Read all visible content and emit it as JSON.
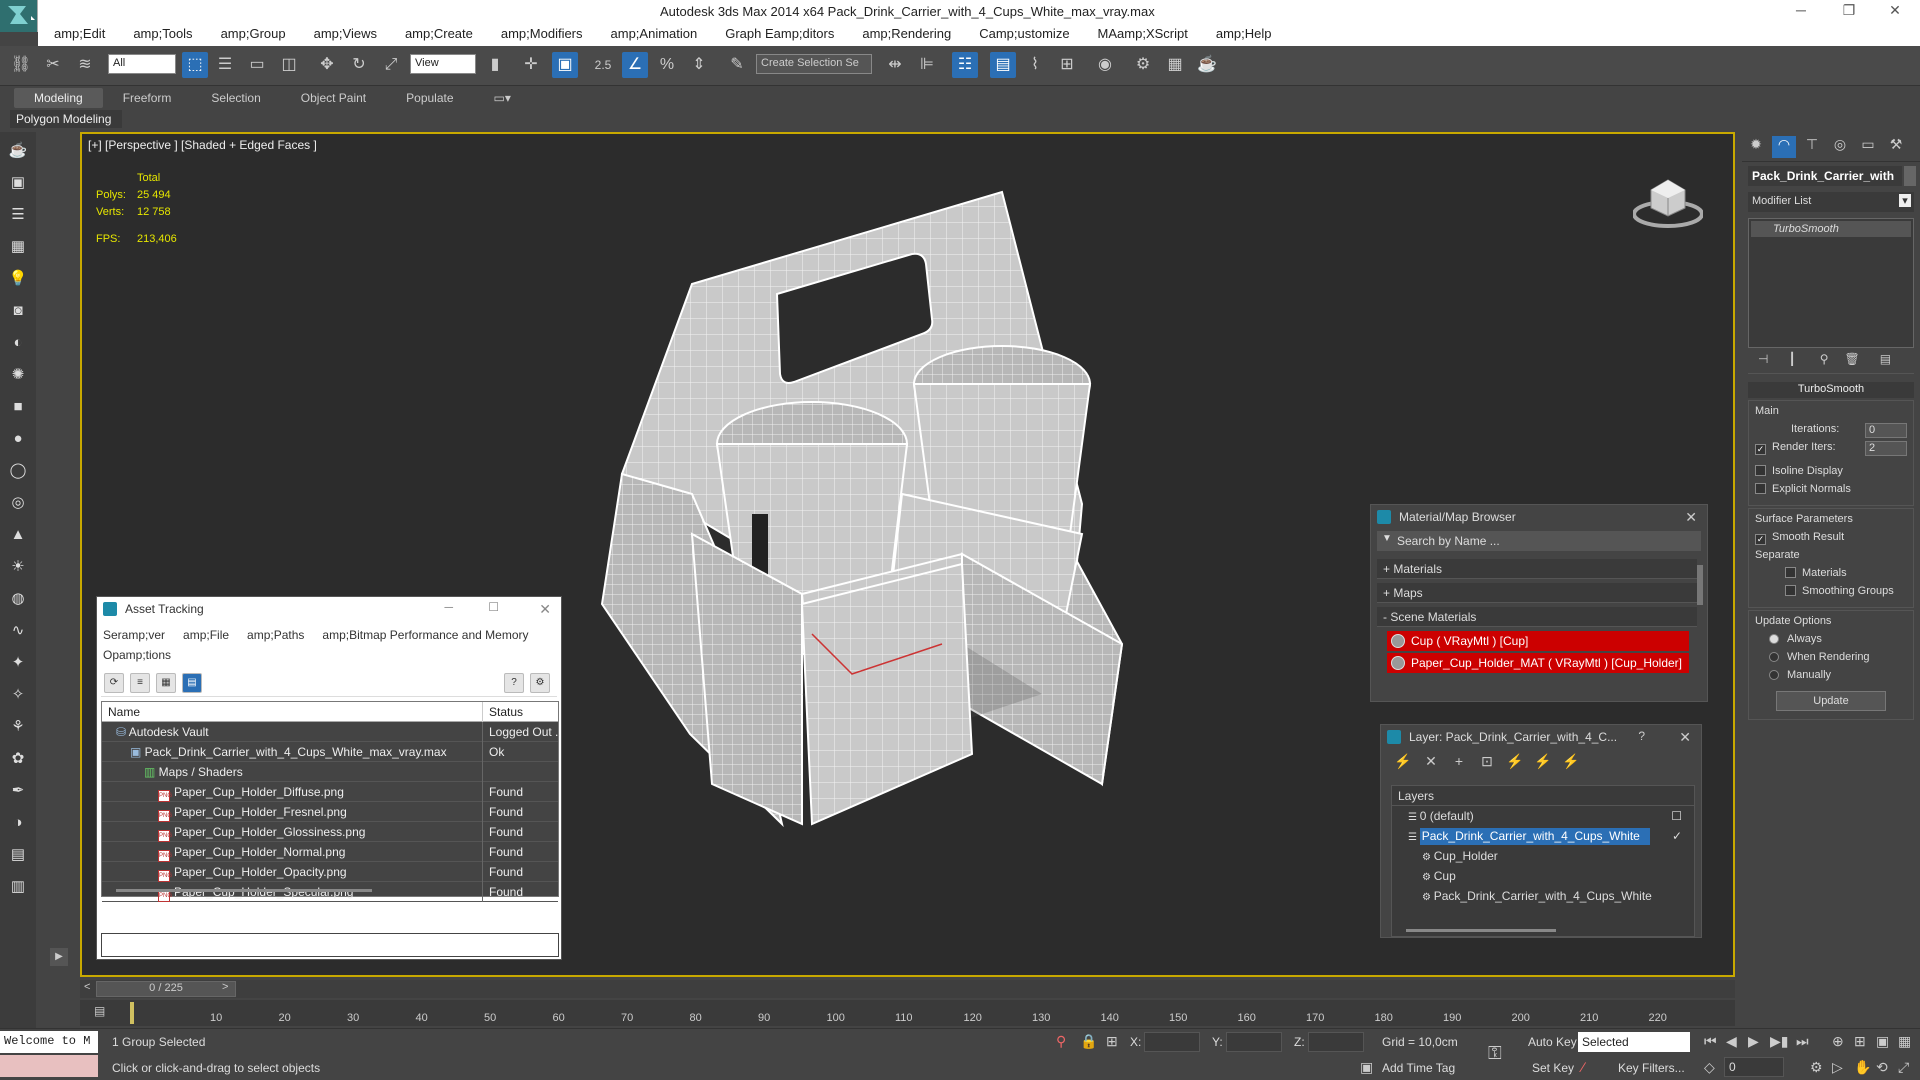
{
  "app": {
    "title": "Autodesk 3ds Max  2014 x64     Pack_Drink_Carrier_with_4_Cups_White_max_vray.max",
    "window_controls": {
      "minimize": "─",
      "restore": "❐",
      "close": "✕"
    }
  },
  "menu": [
    "amp;Edit",
    "amp;Tools",
    "amp;Group",
    "amp;Views",
    "amp;Create",
    "amp;Modifiers",
    "amp;Animation",
    "Graph Eamp;ditors",
    "amp;Rendering",
    "Camp;ustomize",
    "MAamp;XScript",
    "amp;Help"
  ],
  "toolbar": {
    "filter_select": "All",
    "refcoord_select": "View",
    "snap_label": "2.5",
    "selection_set_placeholder": "Create Selection Se"
  },
  "ribbon": {
    "tabs": [
      "Modeling",
      "Freeform",
      "Selection",
      "Object Paint",
      "Populate"
    ],
    "active_tab": "Modeling",
    "panel_label": "Polygon Modeling"
  },
  "viewport": {
    "label": "[+] [Perspective ] [Shaded + Edged Faces ]",
    "stats": {
      "total_label": "Total",
      "polys_label": "Polys:",
      "polys_value": "25 494",
      "verts_label": "Verts:",
      "verts_value": "12 758",
      "fps_label": "FPS:",
      "fps_value": "213,406"
    },
    "accent_color": "#c8a900"
  },
  "asset_tracking": {
    "title": "Asset Tracking",
    "menu": [
      "Seramp;ver",
      "amp;File",
      "amp;Paths",
      "amp;Bitmap Performance and Memory",
      "Opamp;tions"
    ],
    "columns": [
      "Name",
      "Status"
    ],
    "rows": [
      {
        "name": "Autodesk Vault",
        "status": "Logged Out ...",
        "indent": 1
      },
      {
        "name": "Pack_Drink_Carrier_with_4_Cups_White_max_vray.max",
        "status": "Ok",
        "indent": 2
      },
      {
        "name": "Maps / Shaders",
        "status": "",
        "indent": 3
      },
      {
        "name": "Paper_Cup_Holder_Diffuse.png",
        "status": "Found",
        "indent": 4
      },
      {
        "name": "Paper_Cup_Holder_Fresnel.png",
        "status": "Found",
        "indent": 4
      },
      {
        "name": "Paper_Cup_Holder_Glossiness.png",
        "status": "Found",
        "indent": 4
      },
      {
        "name": "Paper_Cup_Holder_Normal.png",
        "status": "Found",
        "indent": 4
      },
      {
        "name": "Paper_Cup_Holder_Opacity.png",
        "status": "Found",
        "indent": 4
      },
      {
        "name": "Paper_Cup_Holder_Specular.png",
        "status": "Found",
        "indent": 4
      }
    ]
  },
  "material_browser": {
    "title": "Material/Map Browser",
    "search_placeholder": "Search by Name ...",
    "sections": [
      "+ Materials",
      "+ Maps",
      "- Scene Materials"
    ],
    "items": [
      "Cup  ( VRayMtl ) [Cup]",
      "Paper_Cup_Holder_MAT ( VRayMtl ) [Cup_Holder]"
    ]
  },
  "layer_panel": {
    "title": "Layer: Pack_Drink_Carrier_with_4_C...",
    "help": "?",
    "header": "Layers",
    "layers": [
      {
        "name": "0 (default)",
        "indent": 0
      },
      {
        "name": "Pack_Drink_Carrier_with_4_Cups_White",
        "indent": 0,
        "selected": true
      },
      {
        "name": "Cup_Holder",
        "indent": 1
      },
      {
        "name": "Cup",
        "indent": 1
      },
      {
        "name": "Pack_Drink_Carrier_with_4_Cups_White",
        "indent": 1
      }
    ]
  },
  "command_panel": {
    "object_name": "Pack_Drink_Carrier_with",
    "modifier_list": "Modifier List",
    "stack_item": "TurboSmooth",
    "rollout_title": "TurboSmooth",
    "main_label": "Main",
    "iterations_label": "Iterations:",
    "iterations_value": "0",
    "render_iters_label": "Render Iters:",
    "render_iters_value": "2",
    "isoline_label": "Isoline Display",
    "explicit_normals_label": "Explicit Normals",
    "surface_params_label": "Surface Parameters",
    "smooth_result_label": "Smooth Result",
    "separate_label": "Separate",
    "materials_label": "Materials",
    "smoothing_groups_label": "Smoothing Groups",
    "update_options_label": "Update Options",
    "always_label": "Always",
    "when_rendering_label": "When Rendering",
    "manually_label": "Manually",
    "update_button": "Update"
  },
  "timeline": {
    "frame_label": "0 / 225",
    "ticks": [
      "10",
      "20",
      "30",
      "40",
      "50",
      "60",
      "70",
      "80",
      "90",
      "100",
      "110",
      "120",
      "130",
      "140",
      "150",
      "160",
      "170",
      "180",
      "190",
      "200",
      "210",
      "220"
    ]
  },
  "status": {
    "maxscript_text": "Welcome to M",
    "selection_text": "1 Group Selected",
    "prompt_text": "Click or click-and-drag to select objects",
    "x_label": "X:",
    "y_label": "Y:",
    "z_label": "Z:",
    "grid_text": "Grid = 10,0cm",
    "add_time_tag": "Add Time Tag",
    "auto_key": "Auto Key",
    "set_key": "Set Key",
    "selected_value": "Selected",
    "key_filters": "Key Filters...",
    "frame_value": "0"
  }
}
